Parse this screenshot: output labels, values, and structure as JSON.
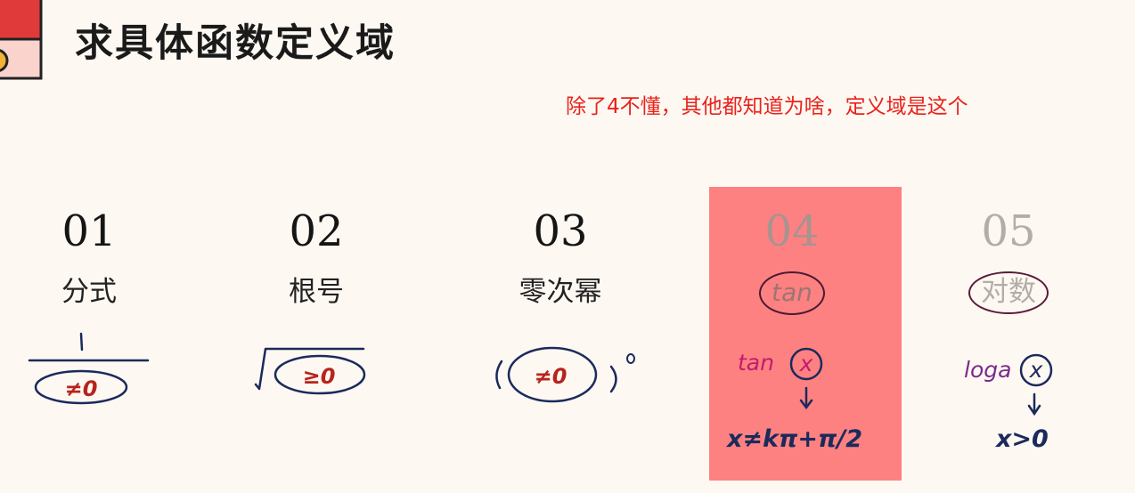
{
  "header": {
    "title": "求具体函数定义域"
  },
  "note": "除了4不懂，其他都知道为啥，定义域是这个",
  "items": [
    {
      "num": "01",
      "label": "分式",
      "annot": "≠0"
    },
    {
      "num": "02",
      "label": "根号",
      "annot": "≥0"
    },
    {
      "num": "03",
      "label": "零次幂",
      "annot": "≠0"
    },
    {
      "num": "04",
      "label": "tan",
      "annot_fn": "tan",
      "annot_var": "x",
      "annot_result": "x≠kπ+π/2"
    },
    {
      "num": "05",
      "label": "对数",
      "annot_fn": "loga",
      "annot_var": "x",
      "annot_result": "x>0"
    }
  ],
  "colors": {
    "accent_red": "#e8231b",
    "highlight": "#fd8181",
    "ink_blue": "#1b2a5c",
    "ink_red": "#b8231d",
    "ink_magenta": "#c01c6e",
    "ink_purple": "#7a2a8c"
  }
}
